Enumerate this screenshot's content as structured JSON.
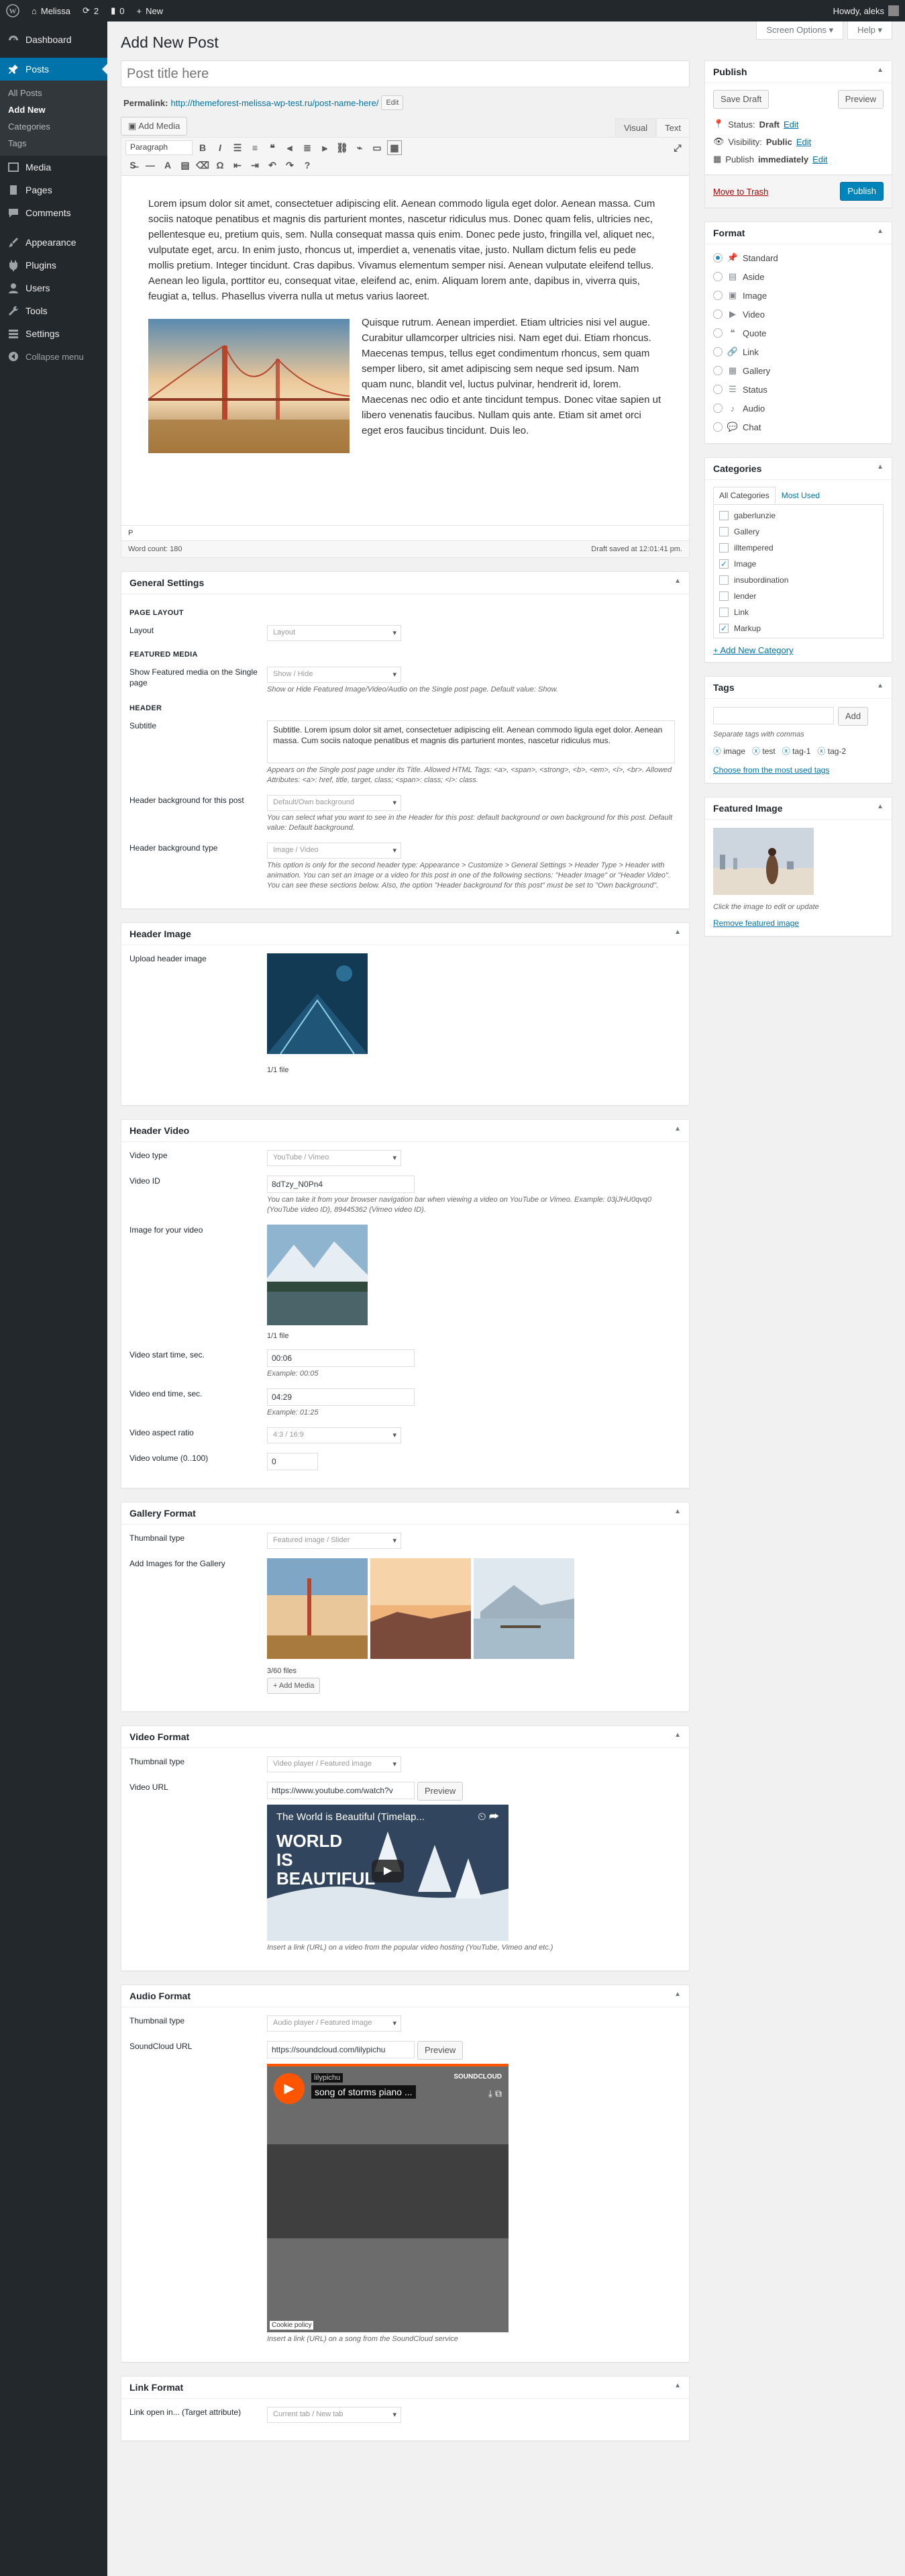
{
  "adminbar": {
    "site": "Melissa",
    "updates": "2",
    "comments": "0",
    "new": "New",
    "howdy": "Howdy, aleks"
  },
  "menu": {
    "dashboard": "Dashboard",
    "posts": "Posts",
    "posts_sub": [
      "All Posts",
      "Add New",
      "Categories",
      "Tags"
    ],
    "media": "Media",
    "pages": "Pages",
    "comments": "Comments",
    "appearance": "Appearance",
    "plugins": "Plugins",
    "users": "Users",
    "tools": "Tools",
    "settings": "Settings",
    "collapse": "Collapse menu"
  },
  "screen_options": "Screen Options ▾",
  "help": "Help ▾",
  "page_title": "Add New Post",
  "post_title_placeholder": "Post title here",
  "permalink": {
    "label": "Permalink:",
    "url": "http://themeforest-melissa-wp-test.ru/post-name-here/",
    "edit": "Edit"
  },
  "editor": {
    "add_media": "Add Media",
    "tab_visual": "Visual",
    "tab_text": "Text",
    "paragraph": "Paragraph",
    "p1": "Lorem ipsum dolor sit amet, consectetuer adipiscing elit. Aenean commodo ligula eget dolor. Aenean massa. Cum sociis natoque penatibus et magnis dis parturient montes, nascetur ridiculus mus. Donec quam felis, ultricies nec, pellentesque eu, pretium quis, sem. Nulla consequat massa quis enim. Donec pede justo, fringilla vel, aliquet nec, vulputate eget, arcu. In enim justo, rhoncus ut, imperdiet a, venenatis vitae, justo. Nullam dictum felis eu pede mollis pretium. Integer tincidunt. Cras dapibus. Vivamus elementum semper nisi. Aenean vulputate eleifend tellus. Aenean leo ligula, porttitor eu, consequat vitae, eleifend ac, enim. Aliquam lorem ante, dapibus in, viverra quis, feugiat a, tellus. Phasellus viverra nulla ut metus varius laoreet.",
    "p2": "Quisque rutrum. Aenean imperdiet. Etiam ultricies nisi vel augue. Curabitur ullamcorper ultricies nisi. Nam eget dui. Etiam rhoncus. Maecenas tempus, tellus eget condimentum rhoncus, sem quam semper libero, sit amet adipiscing sem neque sed ipsum. Nam quam nunc, blandit vel, luctus pulvinar, hendrerit id, lorem. Maecenas nec odio et ante tincidunt tempus. Donec vitae sapien ut libero venenatis faucibus. Nullam quis ante. Etiam sit amet orci eget eros faucibus tincidunt. Duis leo.",
    "path": "P",
    "word_count": "Word count: 180",
    "draft_saved": "Draft saved at 12:01:41 pm."
  },
  "general": {
    "title": "General Settings",
    "page_layout": "PAGE LAYOUT",
    "layout_label": "Layout",
    "layout_value": "Layout",
    "featured_media": "FEATURED MEDIA",
    "show_label": "Show Featured media on the Single page",
    "show_value": "Show / Hide",
    "show_hint": "Show or Hide Featured Image/Video/Audio on the Single post page. Default value: Show.",
    "header": "HEADER",
    "subtitle_label": "Subtitle",
    "subtitle_value": "Subtitle. Lorem ipsum dolor sit amet, consectetuer adipiscing elit. Aenean commodo ligula eget dolor. Aenean massa. Cum sociis natoque penatibus et magnis dis parturient montes, nascetur ridiculus mus.",
    "subtitle_hint": "Appears on the Single post page under its Title. Allowed HTML Tags: <a>, <span>, <strong>, <b>, <em>, <i>, <br>. Allowed Attributes: <a>: href, title, target, class; <span>: class; <i>: class.",
    "hbg_label": "Header background for this post",
    "hbg_value": "Default/Own background",
    "hbg_hint": "You can select what you want to see in the Header for this post: default background or own background for this post. Default value: Default background.",
    "hbt_label": "Header background type",
    "hbt_value": "Image / Video",
    "hbt_hint": "This option is only for the second header type: Appearance > Customize > General Settings > Header Type > Header with animation. You can set an image or a video for this post in one of the following sections: \"Header Image\" or \"Header Video\". You can see these sections below. Also, the option \"Header background for this post\" must be set to \"Own background\"."
  },
  "header_image": {
    "title": "Header Image",
    "label": "Upload header image",
    "count": "1/1 file"
  },
  "header_video": {
    "title": "Header Video",
    "type_label": "Video type",
    "type_value": "YouTube / Vimeo",
    "id_label": "Video ID",
    "id_value": "8dTzy_N0Pn4",
    "id_hint": "You can take it from your browser navigation bar when viewing a video on YouTube or Vimeo. Example: 03jJHU0qvq0 (YouTube video ID), 89445362 (Vimeo video ID).",
    "img_label": "Image for your video",
    "img_count": "1/1 file",
    "start_label": "Video start time, sec.",
    "start_value": "00:06",
    "start_hint": "Example: 00:05",
    "end_label": "Video end time, sec.",
    "end_value": "04:29",
    "end_hint": "Example: 01:25",
    "ratio_label": "Video aspect ratio",
    "ratio_value": "4:3 / 16:9",
    "vol_label": "Video volume (0..100)",
    "vol_value": "0"
  },
  "gallery": {
    "title": "Gallery Format",
    "thumb_label": "Thumbnail type",
    "thumb_value": "Featured image / Slider",
    "add_label": "Add Images for the Gallery",
    "count": "3/60 files",
    "add_btn": "+ Add Media"
  },
  "video_format": {
    "title": "Video Format",
    "thumb_label": "Thumbnail type",
    "thumb_value": "Video player / Featured image",
    "url_label": "Video URL",
    "url_value": "https://www.youtube.com/watch?v",
    "preview": "Preview",
    "yt_title": "The World is Beautiful (Timelap...",
    "yt_big": "WORLD IS BEAUTIFUL",
    "hint": "Insert a link (URL) on a video from the popular video hosting (YouTube, Vimeo and etc.)"
  },
  "audio_format": {
    "title": "Audio Format",
    "thumb_label": "Thumbnail type",
    "thumb_value": "Audio player / Featured image",
    "url_label": "SoundCloud URL",
    "url_value": "https://soundcloud.com/lilypichu",
    "preview": "Preview",
    "sc_user": "lilypichu",
    "sc_track": "song of storms piano ...",
    "sc_logo": "SOUNDCLOUD",
    "cookie": "Cookie policy",
    "hint": "Insert a link (URL) on a song from the SoundCloud service"
  },
  "link_format": {
    "title": "Link Format",
    "label": "Link open in... (Target attribute)",
    "value": "Current tab / New tab"
  },
  "publish": {
    "title": "Publish",
    "save_draft": "Save Draft",
    "preview": "Preview",
    "status": "Status:",
    "status_val": "Draft",
    "visibility": "Visibility:",
    "visibility_val": "Public",
    "publish_label": "Publish",
    "publish_val": "immediately",
    "edit": "Edit",
    "trash": "Move to Trash",
    "publish_btn": "Publish"
  },
  "format": {
    "title": "Format",
    "items": [
      {
        "label": "Standard",
        "glyph": "📌"
      },
      {
        "label": "Aside",
        "glyph": "▤"
      },
      {
        "label": "Image",
        "glyph": "▣"
      },
      {
        "label": "Video",
        "glyph": "▶"
      },
      {
        "label": "Quote",
        "glyph": "❝"
      },
      {
        "label": "Link",
        "glyph": "🔗"
      },
      {
        "label": "Gallery",
        "glyph": "▦"
      },
      {
        "label": "Status",
        "glyph": "☰"
      },
      {
        "label": "Audio",
        "glyph": "♪"
      },
      {
        "label": "Chat",
        "glyph": "💬"
      }
    ],
    "selected": "Standard"
  },
  "categories": {
    "title": "Categories",
    "tab_all": "All Categories",
    "tab_used": "Most Used",
    "items": [
      {
        "label": "gaberlunzie",
        "checked": false
      },
      {
        "label": "Gallery",
        "checked": false
      },
      {
        "label": "illtempered",
        "checked": false
      },
      {
        "label": "Image",
        "checked": true
      },
      {
        "label": "insubordination",
        "checked": false
      },
      {
        "label": "lender",
        "checked": false
      },
      {
        "label": "Link",
        "checked": false
      },
      {
        "label": "Markup",
        "checked": true
      }
    ],
    "add": "+ Add New Category"
  },
  "tags": {
    "title": "Tags",
    "add": "Add",
    "sep": "Separate tags with commas",
    "items": [
      "image",
      "test",
      "tag-1",
      "tag-2"
    ],
    "choose": "Choose from the most used tags"
  },
  "featured": {
    "title": "Featured Image",
    "hint": "Click the image to edit or update",
    "remove": "Remove featured image"
  }
}
